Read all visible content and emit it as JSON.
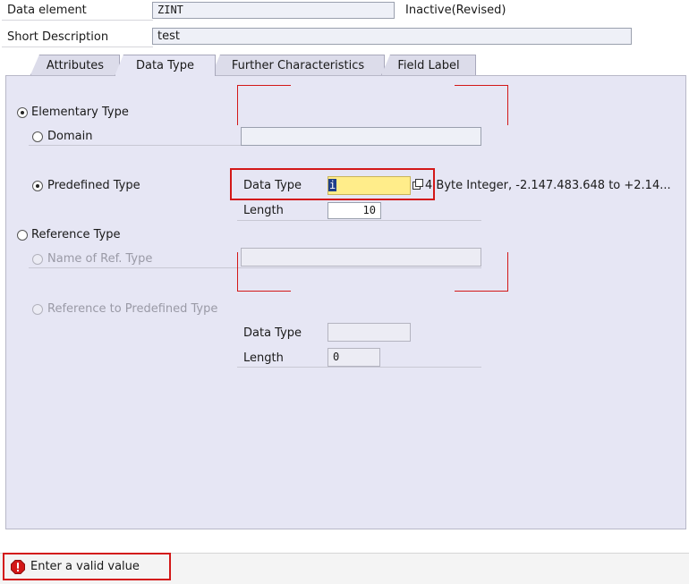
{
  "header": {
    "data_element_label": "Data element",
    "data_element_value": "ZINT",
    "status": "Inactive(Revised)",
    "short_description_label": "Short Description",
    "short_description_value": "test"
  },
  "tabs": [
    {
      "label": "Attributes",
      "active": false
    },
    {
      "label": "Data Type",
      "active": true
    },
    {
      "label": "Further Characteristics",
      "active": false
    },
    {
      "label": "Field Label",
      "active": false
    }
  ],
  "data_type_tab": {
    "elementary_type": "Elementary Type",
    "domain": "Domain",
    "domain_value": "",
    "predefined_type": "Predefined Type",
    "data_type_label": "Data Type",
    "data_type_value": "i",
    "data_type_description": "4 Byte Integer, -2.147.483.648 to +2.14...",
    "length_label": "Length",
    "length_value": "10",
    "reference_type": "Reference Type",
    "name_of_ref_type": "Name of Ref. Type",
    "name_of_ref_type_value": "",
    "reference_to_predefined_type": "Reference to Predefined Type",
    "ref_data_type_label": "Data Type",
    "ref_data_type_value": "",
    "ref_length_label": "Length",
    "ref_length_value": "0"
  },
  "status_bar": {
    "message": "Enter a valid value",
    "icon": "error-icon",
    "color": "#d31818"
  }
}
